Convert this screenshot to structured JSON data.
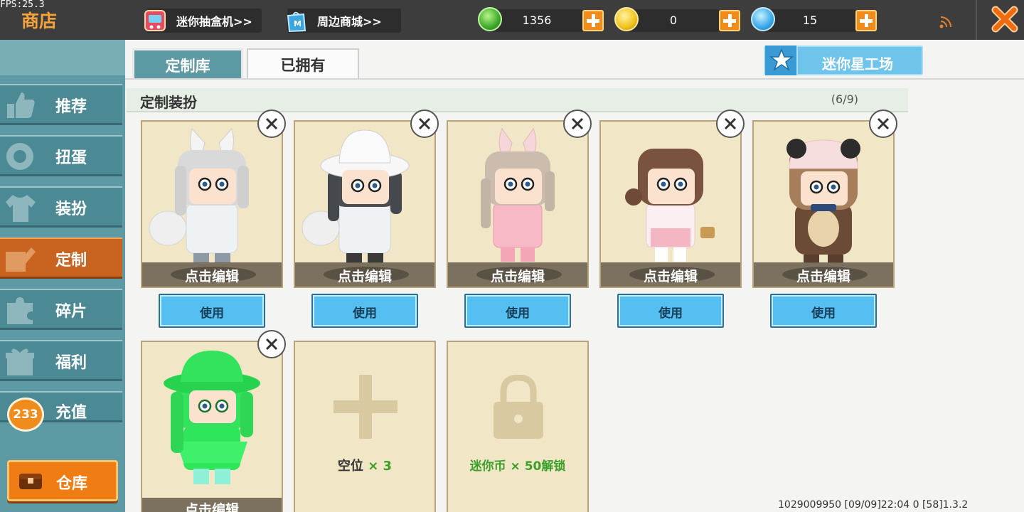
{
  "fps": "FPS:25.3",
  "app_title": "商店",
  "top_links": {
    "gacha": "迷你抽盒机>>",
    "merch": "周边商城>>"
  },
  "currencies": {
    "gems": "1356",
    "coins": "0",
    "mini": "15"
  },
  "sidebar": {
    "items": [
      {
        "label": "推荐",
        "icon": "thumbs-up-icon"
      },
      {
        "label": "扭蛋",
        "icon": "capsule-icon"
      },
      {
        "label": "装扮",
        "icon": "shirt-icon"
      },
      {
        "label": "定制",
        "icon": "pencil-icon"
      },
      {
        "label": "碎片",
        "icon": "puzzle-icon"
      },
      {
        "label": "福利",
        "icon": "gift-icon"
      },
      {
        "label": "充值",
        "icon": "coin-icon"
      }
    ],
    "badge": "233",
    "warehouse": "仓库"
  },
  "tabs": {
    "custom_library": "定制库",
    "owned": "已拥有"
  },
  "workshop": "迷你星工场",
  "section": {
    "title": "定制装扮",
    "count": "(6/9)"
  },
  "cards": {
    "edit_label": "点击编辑",
    "use_label": "使用",
    "empty_label": "空位",
    "empty_count": "× 3",
    "locked_label": "迷你币 × 50解锁"
  },
  "colors": {
    "accent_orange": "#f08c1c",
    "teal": "#5e9aa3",
    "use_blue": "#55bff2",
    "green_text": "#3aa02a"
  },
  "footer": "1029009950  [09/09]22:04 0  [58]1.3.2"
}
